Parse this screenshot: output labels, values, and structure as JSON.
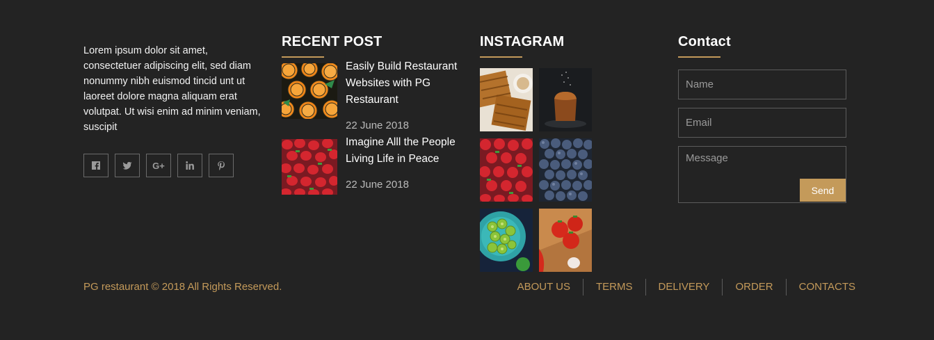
{
  "about": {
    "text": "Lorem ipsum dolor sit amet, consectetuer adipiscing elit, sed diam nonummy nibh euismod tincid unt ut laoreet dolore magna aliquam erat volutpat. Ut wisi enim ad minim veniam, suscipit",
    "social": [
      {
        "icon": "facebook-icon"
      },
      {
        "icon": "twitter-icon"
      },
      {
        "icon": "google-plus-icon",
        "glyph": "G+"
      },
      {
        "icon": "linkedin-icon"
      },
      {
        "icon": "pinterest-icon"
      }
    ]
  },
  "recent_post": {
    "heading": "RECENT POST",
    "posts": [
      {
        "title": "Easily Build Restaurant Websites with PG Restaurant",
        "date": "22 June 2018",
        "image": "oranges"
      },
      {
        "title": "Imagine Alll the People Living Life in Peace",
        "date": "22 June 2018",
        "image": "strawberries"
      }
    ]
  },
  "instagram": {
    "heading": "INSTAGRAM",
    "images": [
      "waffles",
      "cake",
      "strawberries",
      "blueberries",
      "green-tomatoes",
      "red-tomatoes"
    ]
  },
  "contact": {
    "heading": "Contact",
    "name_placeholder": "Name",
    "email_placeholder": "Email",
    "message_placeholder": "Message",
    "send_label": "Send"
  },
  "footer": {
    "copyright": "PG restaurant © 2018 All Rights Reserved.",
    "nav": [
      "ABOUT US",
      "TERMS",
      "DELIVERY",
      "ORDER",
      "CONTACTS"
    ]
  },
  "colors": {
    "background": "#232323",
    "accent": "#c49a5a"
  }
}
